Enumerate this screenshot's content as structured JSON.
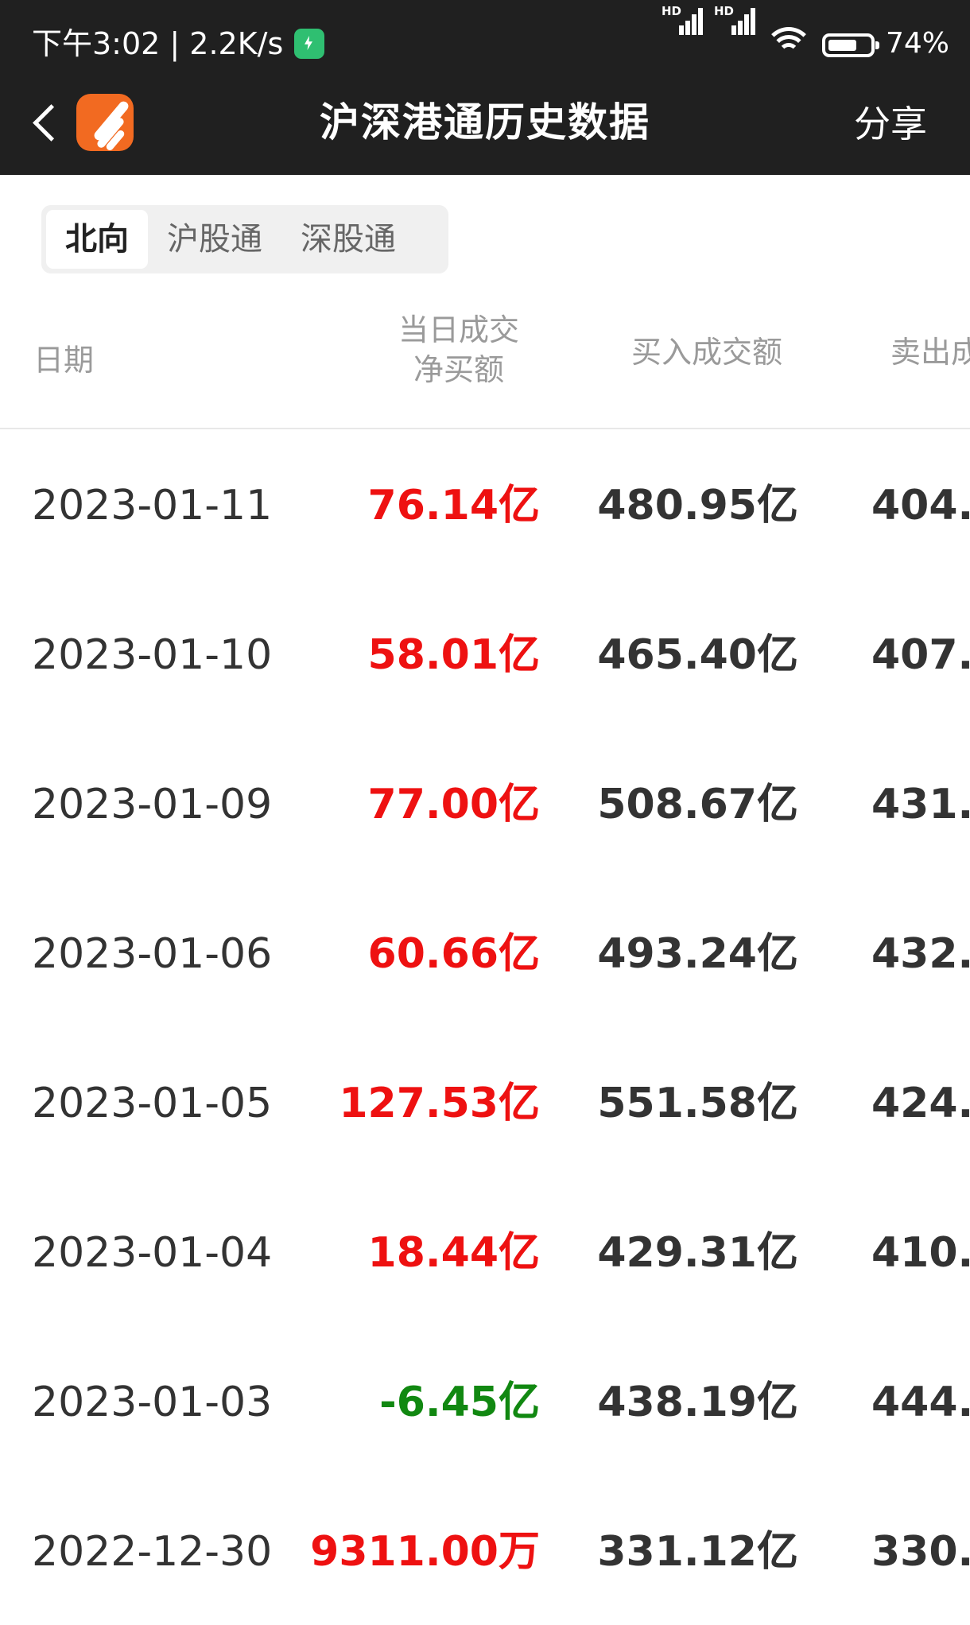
{
  "status_bar": {
    "time_speed": "下午3:02 | 2.2K/s",
    "signal_1_label": "HD",
    "signal_2_label": "HD",
    "battery_percent": "74%",
    "battery_level": 0.74
  },
  "nav": {
    "title": "沪深港通历史数据",
    "share_label": "分享"
  },
  "tabs": [
    {
      "label": "北向",
      "active": true
    },
    {
      "label": "沪股通",
      "active": false
    },
    {
      "label": "深股通",
      "active": false
    }
  ],
  "table": {
    "headers": {
      "date": "日期",
      "net_line1": "当日成交",
      "net_line2": "净买额",
      "buy": "买入成交额",
      "sell": "卖出成"
    },
    "rows": [
      {
        "date": "2023-01-11",
        "net": "76.14亿",
        "buy": "480.95亿",
        "sell": "404.",
        "net_color": "#ee1111"
      },
      {
        "date": "2023-01-10",
        "net": "58.01亿",
        "buy": "465.40亿",
        "sell": "407.",
        "net_color": "#ee1111"
      },
      {
        "date": "2023-01-09",
        "net": "77.00亿",
        "buy": "508.67亿",
        "sell": "431.",
        "net_color": "#ee1111"
      },
      {
        "date": "2023-01-06",
        "net": "60.66亿",
        "buy": "493.24亿",
        "sell": "432.",
        "net_color": "#ee1111"
      },
      {
        "date": "2023-01-05",
        "net": "127.53亿",
        "buy": "551.58亿",
        "sell": "424.",
        "net_color": "#ee1111"
      },
      {
        "date": "2023-01-04",
        "net": "18.44亿",
        "buy": "429.31亿",
        "sell": "410.",
        "net_color": "#ee1111"
      },
      {
        "date": "2023-01-03",
        "net": "-6.45亿",
        "buy": "438.19亿",
        "sell": "444.",
        "net_color": "#118811"
      },
      {
        "date": "2022-12-30",
        "net": "9311.00万",
        "buy": "331.12亿",
        "sell": "330.",
        "net_color": "#ee1111"
      }
    ]
  }
}
